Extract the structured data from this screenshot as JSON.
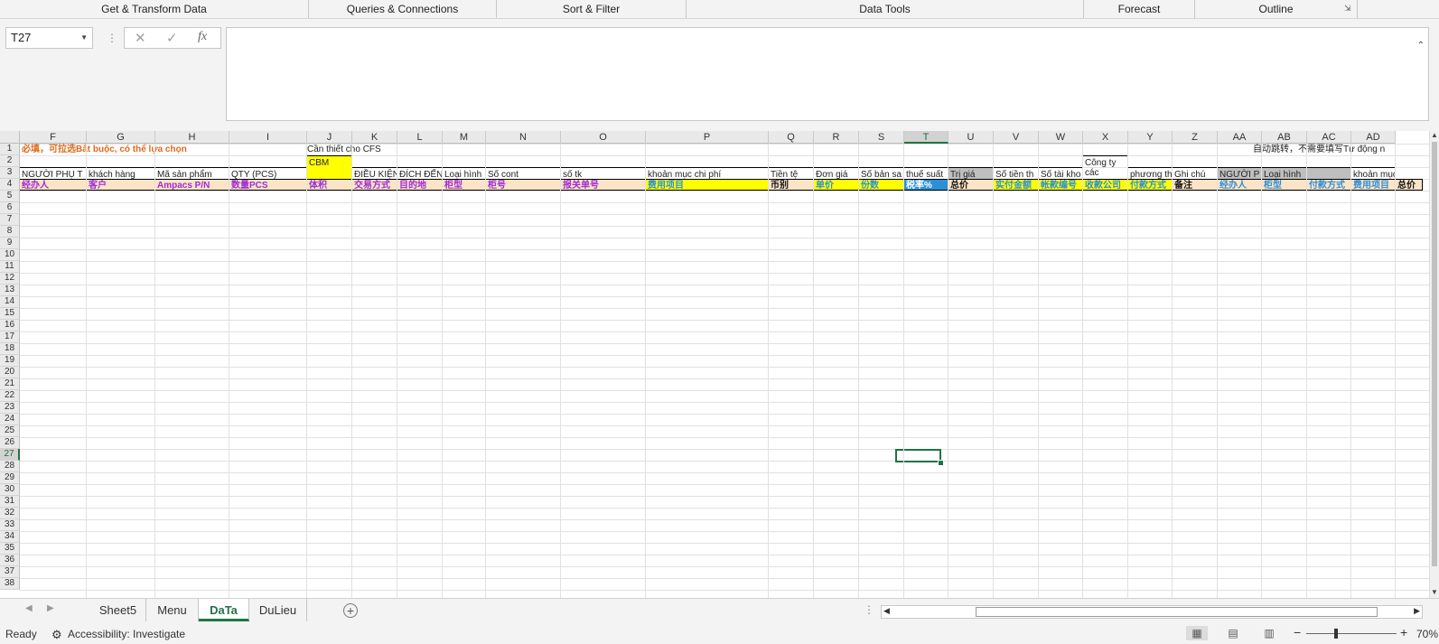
{
  "ribbon_groups": [
    "Get & Transform Data",
    "Queries & Connections",
    "Sort & Filter",
    "Data Tools",
    "Forecast",
    "Outline"
  ],
  "formula_bar": {
    "name_box": "T27",
    "formula": "",
    "fx_label": "fx"
  },
  "columns": [
    "F",
    "G",
    "H",
    "I",
    "J",
    "K",
    "L",
    "M",
    "N",
    "O",
    "P",
    "Q",
    "R",
    "S",
    "T",
    "U",
    "V",
    "W",
    "X",
    "Y",
    "Z",
    "AA",
    "AB",
    "AC",
    "AD"
  ],
  "selected_column": "T",
  "rows": [
    "1",
    "2",
    "3",
    "4",
    "5",
    "6",
    "7",
    "8",
    "9",
    "10",
    "11",
    "12",
    "13",
    "14",
    "15",
    "16",
    "17",
    "18",
    "19",
    "20",
    "21",
    "22",
    "23",
    "24",
    "25",
    "26",
    "27",
    "28",
    "29",
    "30",
    "31",
    "32",
    "33",
    "34",
    "35",
    "36",
    "37",
    "38"
  ],
  "selected_row": "27",
  "row1": {
    "required_note": "必填，可拉选Bắt buộc, có thể lựa chọn",
    "cfs_note": "Cần thiết cho CFS",
    "auto_note": "自动跳转，不需要填写Tự động n"
  },
  "row2": [
    "NGƯỜI PHỤ T",
    "khách hàng",
    "Mã sản phẩm",
    "QTY (PCS)",
    "CBM",
    "ĐIỀU KIỆN",
    "ĐÍCH ĐẾN",
    "Loại hình",
    "Số cont",
    "số tk",
    "khoản mục chi phí",
    "Tiền tệ",
    "Đơn giá",
    "Số bản sa",
    "thuế suất",
    "Trị giá",
    "Số tiền th",
    "Số tài kho",
    "Công ty các",
    "phương th",
    "Ghi chú",
    "NGƯỜI P",
    "Loại hình",
    "",
    "khoản mục chi"
  ],
  "row3": [
    "经办人",
    "客户",
    "Ampacs P/N",
    "数量PCS",
    "体积",
    "交易方式",
    "目的地",
    "柜型",
    "柜号",
    "报关单号",
    "费用项目",
    "币别",
    "单价",
    "份数",
    "税率%",
    "总价",
    "实付金额",
    "帐款编号",
    "收款公司",
    "付款方式",
    "备注",
    "经办人",
    "柜型",
    "付款方式",
    "费用项目",
    "总价"
  ],
  "colors": {
    "required": "#e06a1b",
    "purple": "#a02bd6",
    "blue": "#2f8fd6",
    "yellow": "#ffff00",
    "gray": "#bfbfbf",
    "accent": "#217346"
  },
  "sheet_tabs": [
    "Sheet5",
    "Menu",
    "DaTa",
    "DuLieu"
  ],
  "active_tab": "DaTa",
  "status": {
    "ready": "Ready",
    "accessibility": "Accessibility: Investigate",
    "zoom": "70%"
  }
}
